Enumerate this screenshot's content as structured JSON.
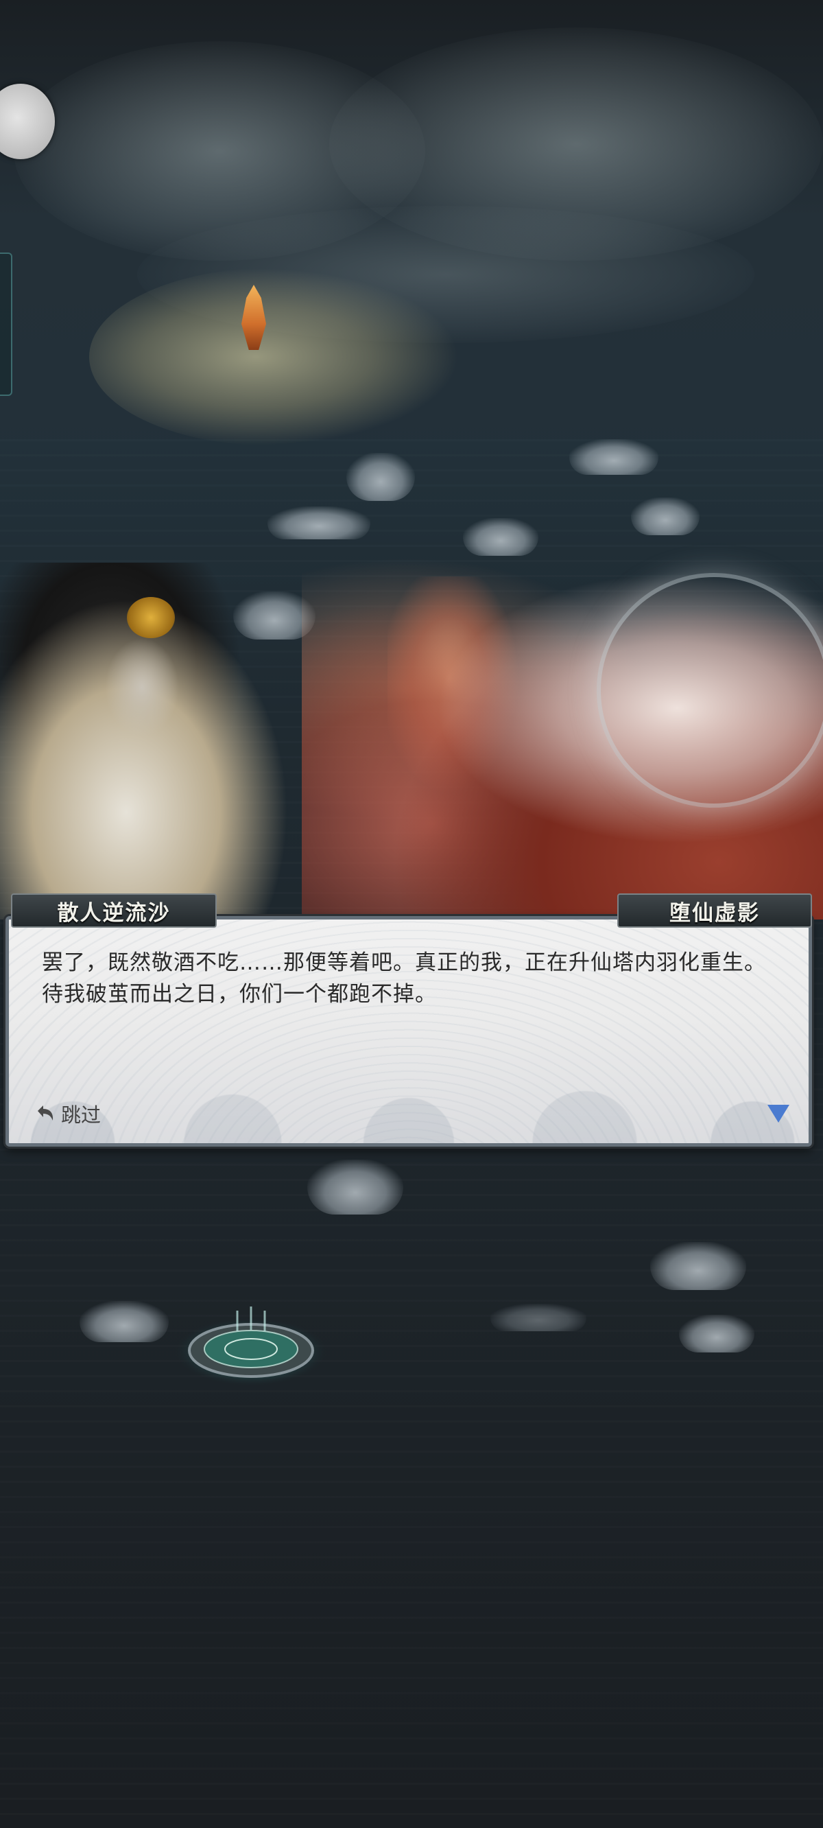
{
  "dialog": {
    "left_speaker": "散人逆流沙",
    "right_speaker": "堕仙虚影",
    "text": "罢了，既然敬酒不吃……那便等着吧。真正的我，正在升仙塔内羽化重生。待我破茧而出之日，你们一个都跑不掉。",
    "skip_label": "跳过"
  },
  "icons": {
    "skip": "undo-arrow-icon",
    "next": "triangle-down-icon",
    "avatar": "player-avatar-icon",
    "portal": "teleport-circle-icon"
  },
  "colors": {
    "dialog_border": "#65707a",
    "next_arrow": "#4a7bd0",
    "portal_glow": "#5cc7c2"
  }
}
